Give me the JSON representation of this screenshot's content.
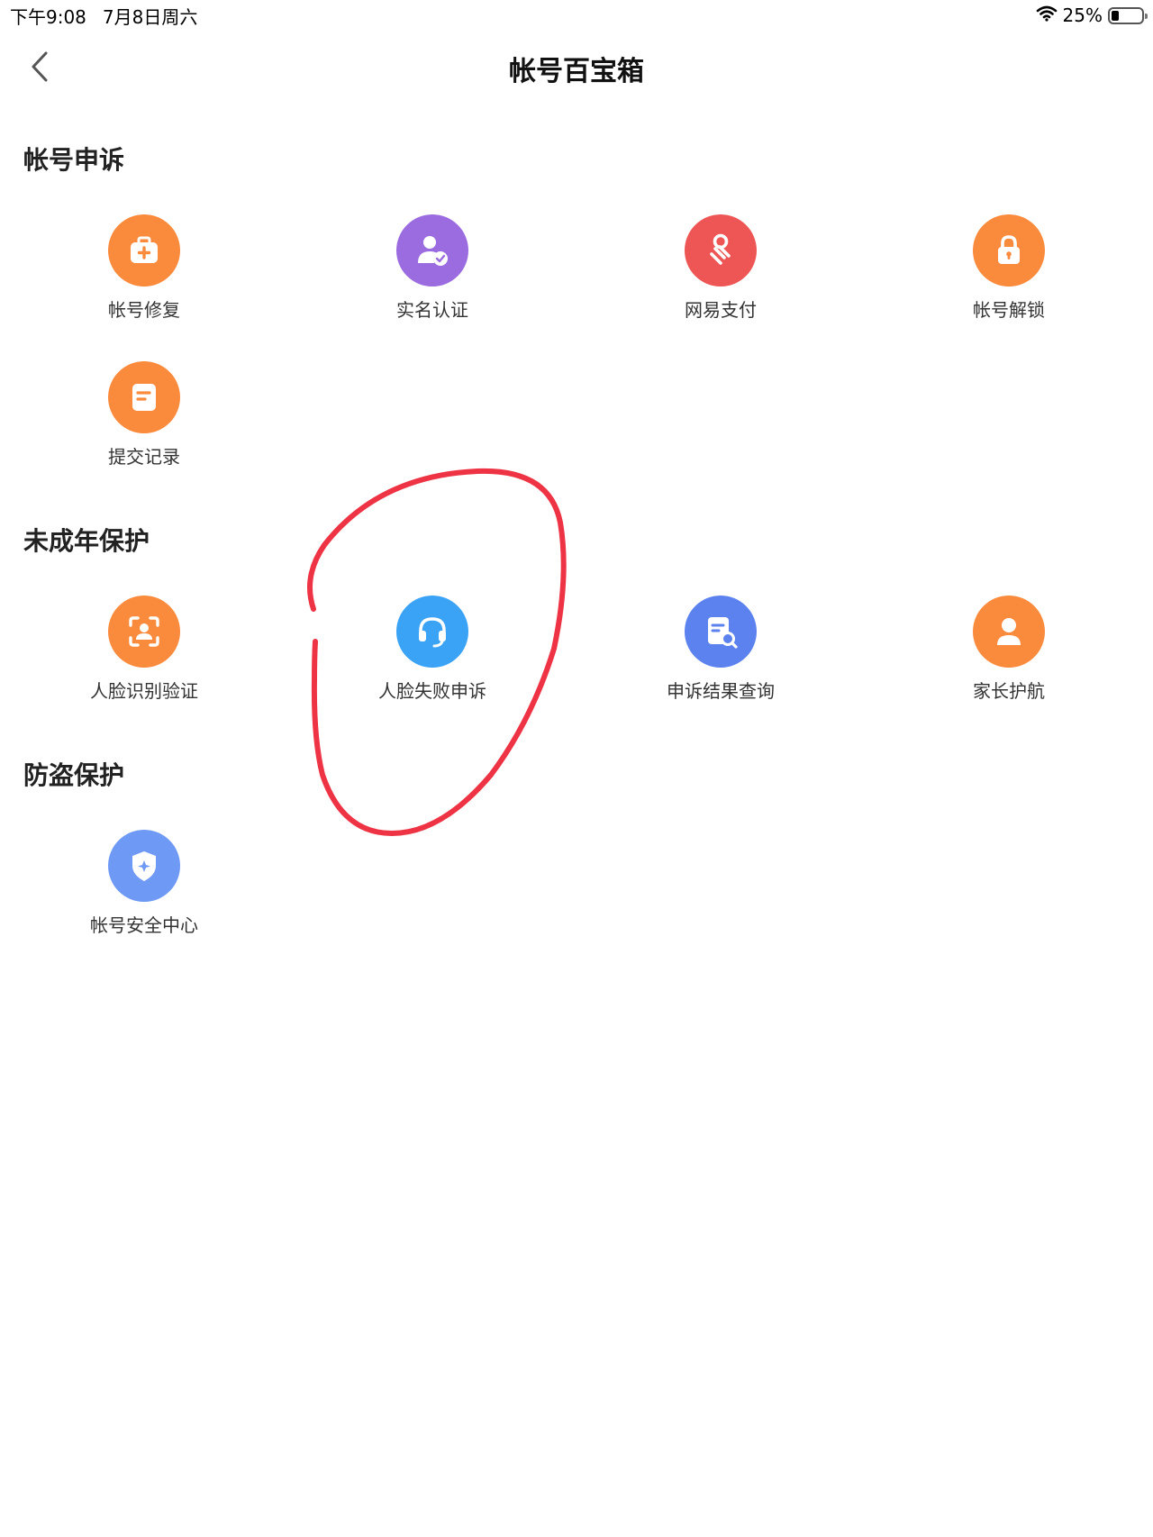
{
  "status_bar": {
    "time": "下午9:08",
    "date": "7月8日周六",
    "battery_percent": "25%",
    "battery_level": 0.25
  },
  "nav": {
    "title": "帐号百宝箱"
  },
  "sections": [
    {
      "title": "帐号申诉",
      "items": [
        {
          "label": "帐号修复",
          "icon": "medical-kit-icon",
          "color": "#FA8A3C"
        },
        {
          "label": "实名认证",
          "icon": "user-verified-icon",
          "color": "#9B6BE0"
        },
        {
          "label": "网易支付",
          "icon": "netease-pay-icon",
          "color": "#EE5555"
        },
        {
          "label": "帐号解锁",
          "icon": "lock-icon",
          "color": "#FA8A3C"
        },
        {
          "label": "提交记录",
          "icon": "document-icon",
          "color": "#FA8A3C"
        }
      ]
    },
    {
      "title": "未成年保护",
      "items": [
        {
          "label": "人脸识别验证",
          "icon": "face-scan-icon",
          "color": "#FA8A3C"
        },
        {
          "label": "人脸失败申诉",
          "icon": "headset-icon",
          "color": "#3AA3F5"
        },
        {
          "label": "申诉结果查询",
          "icon": "document-search-icon",
          "color": "#5B82EE"
        },
        {
          "label": "家长护航",
          "icon": "parent-icon",
          "color": "#FA8A3C"
        }
      ]
    },
    {
      "title": "防盗保护",
      "items": [
        {
          "label": "帐号安全中心",
          "icon": "shield-icon",
          "color": "#6E99F5"
        }
      ]
    }
  ],
  "annotation": {
    "color": "#EE3344",
    "target": "人脸失败申诉"
  }
}
